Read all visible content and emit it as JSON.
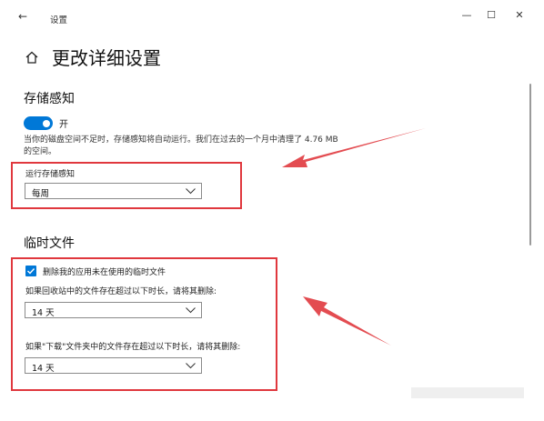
{
  "window": {
    "title": "设置",
    "back_icon": "←",
    "controls": {
      "minimize": "—",
      "maximize": "☐",
      "close": "✕"
    }
  },
  "header": {
    "title": "更改详细设置"
  },
  "storage": {
    "title": "存储感知",
    "toggle_state": "开",
    "toggle_on": true,
    "description": "当你的磁盘空间不足时，存储感知将自动运行。我们在过去的一个月中清理了 4.76 MB 的空间。",
    "run_label": "运行存储感知",
    "run_value": "每周"
  },
  "temp": {
    "title": "临时文件",
    "checkbox_label": "删除我的应用未在使用的临时文件",
    "checkbox_checked": true,
    "recycle_label": "如果回收站中的文件存在超过以下时长，请将其删除:",
    "recycle_value": "14 天",
    "downloads_label": "如果\"下载\"文件夹中的文件存在超过以下时长，请将其删除:",
    "downloads_value": "14 天"
  },
  "colors": {
    "accent": "#0078d7",
    "annotation": "#e0383e"
  }
}
